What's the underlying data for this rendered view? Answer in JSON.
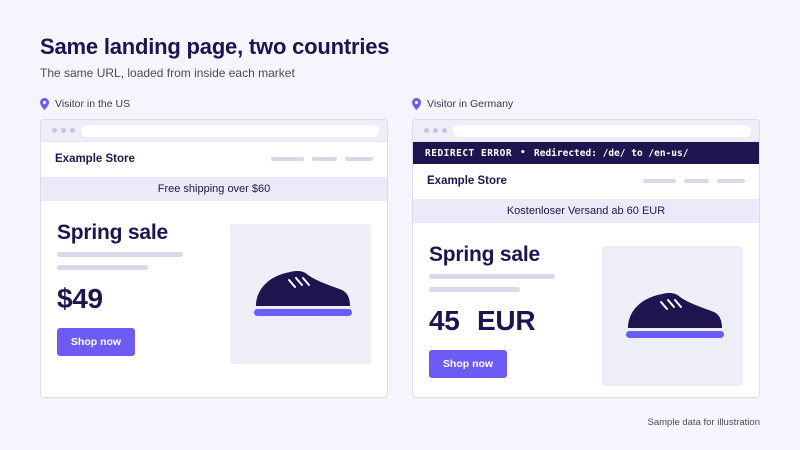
{
  "header": {
    "title": "Same landing page, two countries",
    "subtitle": "The same URL, loaded from inside each market"
  },
  "panels": {
    "us": {
      "visitor_label": "Visitor in the US",
      "store_name": "Example Store",
      "shipping_banner": "Free shipping over $60",
      "headline": "Spring sale",
      "price": "$49",
      "button_label": "Shop now"
    },
    "de": {
      "visitor_label": "Visitor in Germany",
      "redirect_error": {
        "label": "REDIRECT ERROR",
        "separator": "•",
        "detail": "Redirected: /de/ to /en-us/"
      },
      "store_name": "Example Store",
      "shipping_banner": "Kostenloser Versand ab 60 EUR",
      "headline": "Spring sale",
      "price": "45  EUR",
      "button_label": "Shop now"
    }
  },
  "footnote": "Sample data for illustration",
  "icons": {
    "location": "map-pin-icon",
    "product": "shoe-icon"
  },
  "colors": {
    "navy": "#1e1450",
    "accent": "#6c5cf5",
    "background": "#f5f5fd",
    "banner": "#eaeaf9"
  }
}
